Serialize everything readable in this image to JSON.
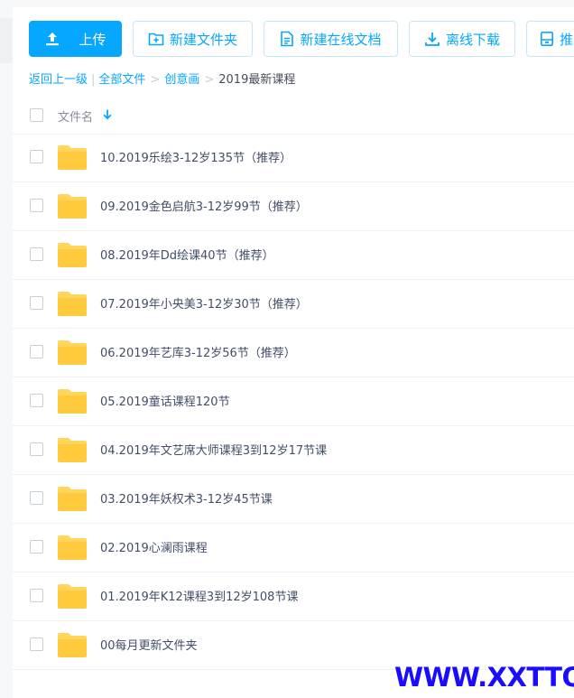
{
  "toolbar": {
    "upload_label": "上传",
    "new_folder_label": "新建文件夹",
    "new_online_doc_label": "新建在线文档",
    "offline_download_label": "离线下载",
    "more_label": "推"
  },
  "breadcrumb": {
    "back_label": "返回上一级",
    "divider": "|",
    "items": [
      "全部文件",
      "创意画",
      "2019最新课程"
    ],
    "separator": ">"
  },
  "list_header": {
    "name_column": "文件名"
  },
  "files": [
    {
      "name": "10.2019乐绘3-12岁135节（推荐）"
    },
    {
      "name": "09.2019金色启航3-12岁99节（推荐）"
    },
    {
      "name": "08.2019年Dd绘课40节（推荐）"
    },
    {
      "name": "07.2019年小央美3-12岁30节（推荐）"
    },
    {
      "name": "06.2019年艺库3-12岁56节（推荐）"
    },
    {
      "name": "05.2019童话课程120节"
    },
    {
      "name": "04.2019年文艺席大师课程3到12岁17节课"
    },
    {
      "name": "03.2019年妖权术3-12岁45节课"
    },
    {
      "name": "02.2019心澜雨课程"
    },
    {
      "name": "01.2019年K12课程3到12岁108节课"
    },
    {
      "name": "00每月更新文件夹"
    }
  ],
  "watermark": "WWW.XXTTQ.COM",
  "colors": {
    "accent": "#06a7ff",
    "folder": "#ffd659",
    "watermark": "#1a0cff"
  },
  "icons": {
    "upload": "upload-icon",
    "new_folder": "folder-plus-icon",
    "online_doc": "document-icon",
    "offline_download": "download-icon",
    "more": "save-icon",
    "sort": "arrow-down-icon",
    "folder": "folder-icon"
  }
}
